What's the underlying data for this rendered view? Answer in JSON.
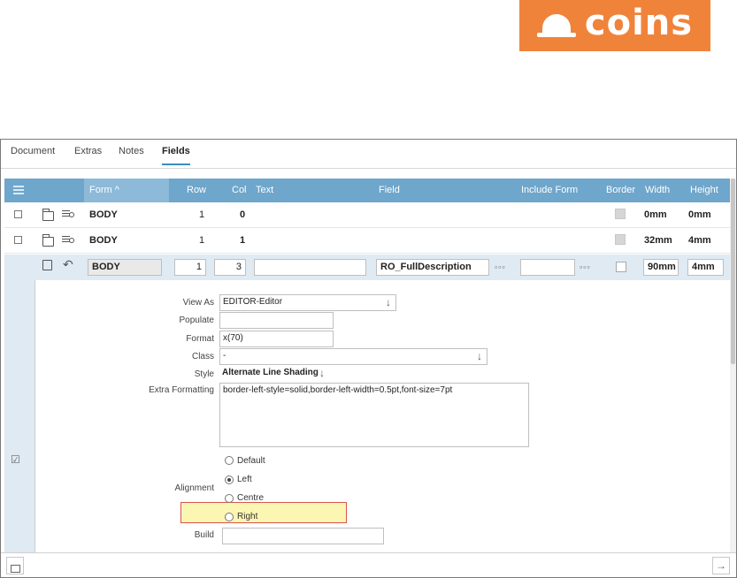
{
  "brand": {
    "logo_text": "coins",
    "logo_color": "#f0833a"
  },
  "tabs": [
    {
      "label": "Document",
      "active": false
    },
    {
      "label": "Extras",
      "active": false
    },
    {
      "label": "Notes",
      "active": false
    },
    {
      "label": "Fields",
      "active": true
    }
  ],
  "grid": {
    "headers": {
      "form": "Form ^",
      "row": "Row",
      "col": "Col",
      "text": "Text",
      "field": "Field",
      "include_form": "Include Form",
      "border": "Border",
      "width": "Width",
      "height": "Height"
    },
    "rows": [
      {
        "form": "BODY",
        "row": "1",
        "col": "0",
        "width": "0mm",
        "height": "0mm"
      },
      {
        "form": "BODY",
        "row": "1",
        "col": "1",
        "width": "32mm",
        "height": "4mm"
      }
    ],
    "edit_row": {
      "form": "BODY",
      "row": "1",
      "col": "3",
      "text": "",
      "field": "RO_FullDescription",
      "include_form": "",
      "width": "90mm",
      "height": "4mm",
      "dots": "▫▫▫"
    }
  },
  "detail": {
    "view_as": {
      "label": "View As",
      "value": "EDITOR-Editor"
    },
    "populate": {
      "label": "Populate",
      "value": ""
    },
    "format": {
      "label": "Format",
      "value": "x(70)"
    },
    "class": {
      "label": "Class",
      "value": "-"
    },
    "style": {
      "label": "Style",
      "value": "Alternate Line Shading"
    },
    "extra_formatting": {
      "label": "Extra Formatting",
      "value": "border-left-style=solid,border-left-width=0.5pt,font-size=7pt"
    },
    "alignment": {
      "label": "Alignment",
      "options": [
        "Default",
        "Left",
        "Centre",
        "Right"
      ],
      "selected": "Left"
    },
    "build": {
      "label": "Build",
      "value": ""
    }
  },
  "icons": {
    "arrow_down": "↓",
    "save": "💾",
    "undo": "↶",
    "check": "☑",
    "next": "→"
  }
}
